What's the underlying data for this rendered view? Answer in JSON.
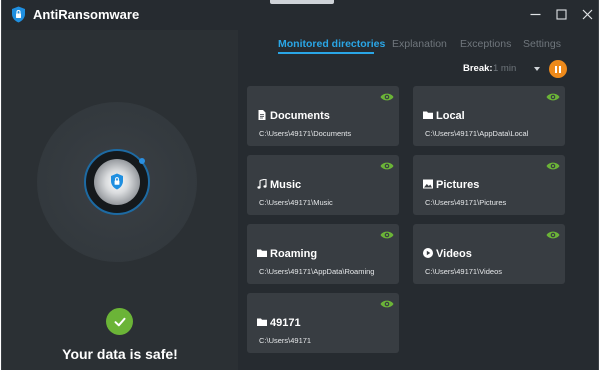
{
  "app": {
    "title": "AntiRansomware"
  },
  "tabs": [
    {
      "label": "Monitored directories",
      "active": true
    },
    {
      "label": "Explanation",
      "active": false
    },
    {
      "label": "Exceptions",
      "active": false
    },
    {
      "label": "Settings",
      "active": false
    }
  ],
  "break_control": {
    "label": "Break:",
    "value": "1 min"
  },
  "status": {
    "text": "Your data is safe!"
  },
  "colors": {
    "accent": "#2aa6e6",
    "safe": "#6bb437",
    "eye": "#6bb437",
    "pause": "#ee8a1b"
  },
  "directories": [
    {
      "name": "Documents",
      "path": "C:\\Users\\49171\\Documents",
      "icon": "document-icon"
    },
    {
      "name": "Local",
      "path": "C:\\Users\\49171\\AppData\\Local",
      "icon": "folder-icon"
    },
    {
      "name": "Music",
      "path": "C:\\Users\\49171\\Music",
      "icon": "music-icon"
    },
    {
      "name": "Pictures",
      "path": "C:\\Users\\49171\\Pictures",
      "icon": "picture-icon"
    },
    {
      "name": "Roaming",
      "path": "C:\\Users\\49171\\AppData\\Roaming",
      "icon": "folder-icon"
    },
    {
      "name": "Videos",
      "path": "C:\\Users\\49171\\Videos",
      "icon": "video-icon"
    },
    {
      "name": "49171",
      "path": "C:\\Users\\49171",
      "icon": "folder-icon"
    }
  ]
}
